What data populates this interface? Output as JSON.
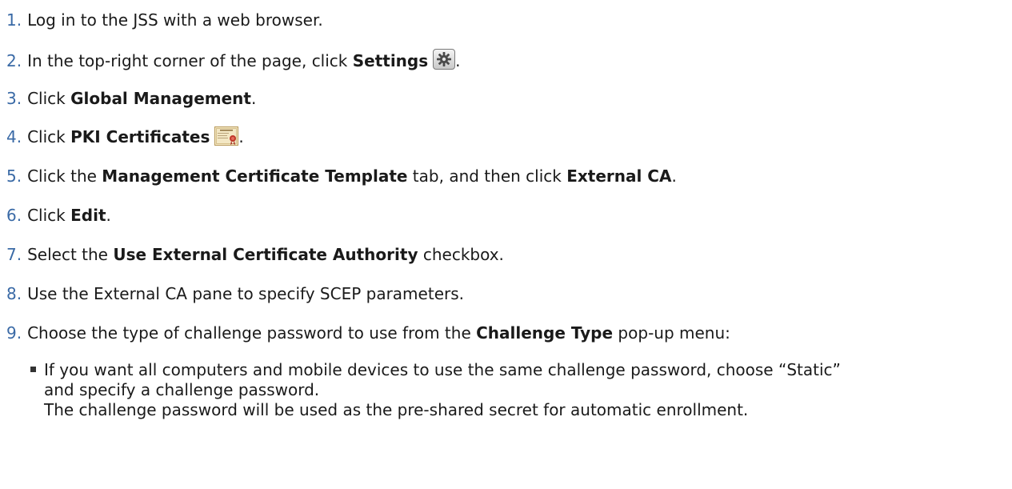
{
  "steps": [
    {
      "num": "1.",
      "pre": "Log in to the JSS with a web browser.",
      "bold": "",
      "post": ""
    },
    {
      "num": "2.",
      "pre": "In the top-right corner of the page, click ",
      "bold": "Settings",
      "post": "."
    },
    {
      "num": "3.",
      "pre": "Click ",
      "bold": "Global Management",
      "post": "."
    },
    {
      "num": "4.",
      "pre": "Click ",
      "bold": "PKI Certificates",
      "post": "."
    },
    {
      "num": "5.",
      "pre": "Click the ",
      "bold": "Management Certificate Template",
      "mid": " tab, and then click ",
      "bold2": "External CA",
      "post": "."
    },
    {
      "num": "6.",
      "pre": "Click ",
      "bold": "Edit",
      "post": "."
    },
    {
      "num": "7.",
      "pre": "Select the ",
      "bold": "Use External Certificate Authority",
      "post": " checkbox."
    },
    {
      "num": "8.",
      "pre": "Use the External CA pane to specify SCEP parameters.",
      "bold": "",
      "post": ""
    },
    {
      "num": "9.",
      "pre": "Choose the type of challenge password to use from the ",
      "bold": "Challenge Type",
      "post": " pop-up menu:"
    }
  ],
  "sub": {
    "line1": "If you want all computers and mobile devices to use the same challenge password, choose “Static”",
    "line2": "and specify a challenge password.",
    "line3": "The challenge password will be used as the pre-shared secret for automatic enrollment."
  },
  "icons": {
    "settings": "gear-icon",
    "pki": "certificate-icon"
  },
  "colors": {
    "number": "#3a6aa6",
    "text": "#1a1a1a"
  }
}
